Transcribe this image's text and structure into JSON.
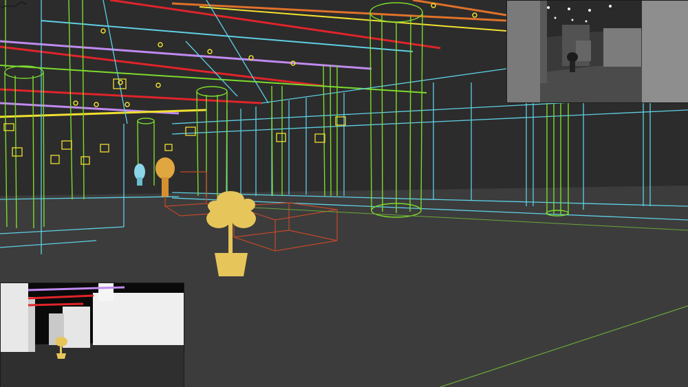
{
  "scene": {
    "background_color": "#3a3a3a",
    "floor_color": "#3d3d3d",
    "ceiling_color": "#2b2b2b",
    "wire_colors": {
      "columns": "#7ddc2c",
      "walls": "#5fd0e6",
      "beams_purple": "#c08af0",
      "beams_red": "#e0242a",
      "beams_orange": "#e0722a",
      "beams_yellow": "#f2e030",
      "lights": "#f2e030",
      "plinths": "#c0482a",
      "plant": "#e6c65a",
      "ground_line": "#6aa83a"
    },
    "icons": [
      "potted-tree-icon",
      "potted-plant-icon",
      "spotlight-icon"
    ]
  },
  "insets": {
    "top_right": {
      "kind": "render-preview",
      "tone": "grayscale"
    },
    "bottom_left": {
      "kind": "shaded-preview",
      "tone": "color"
    }
  }
}
